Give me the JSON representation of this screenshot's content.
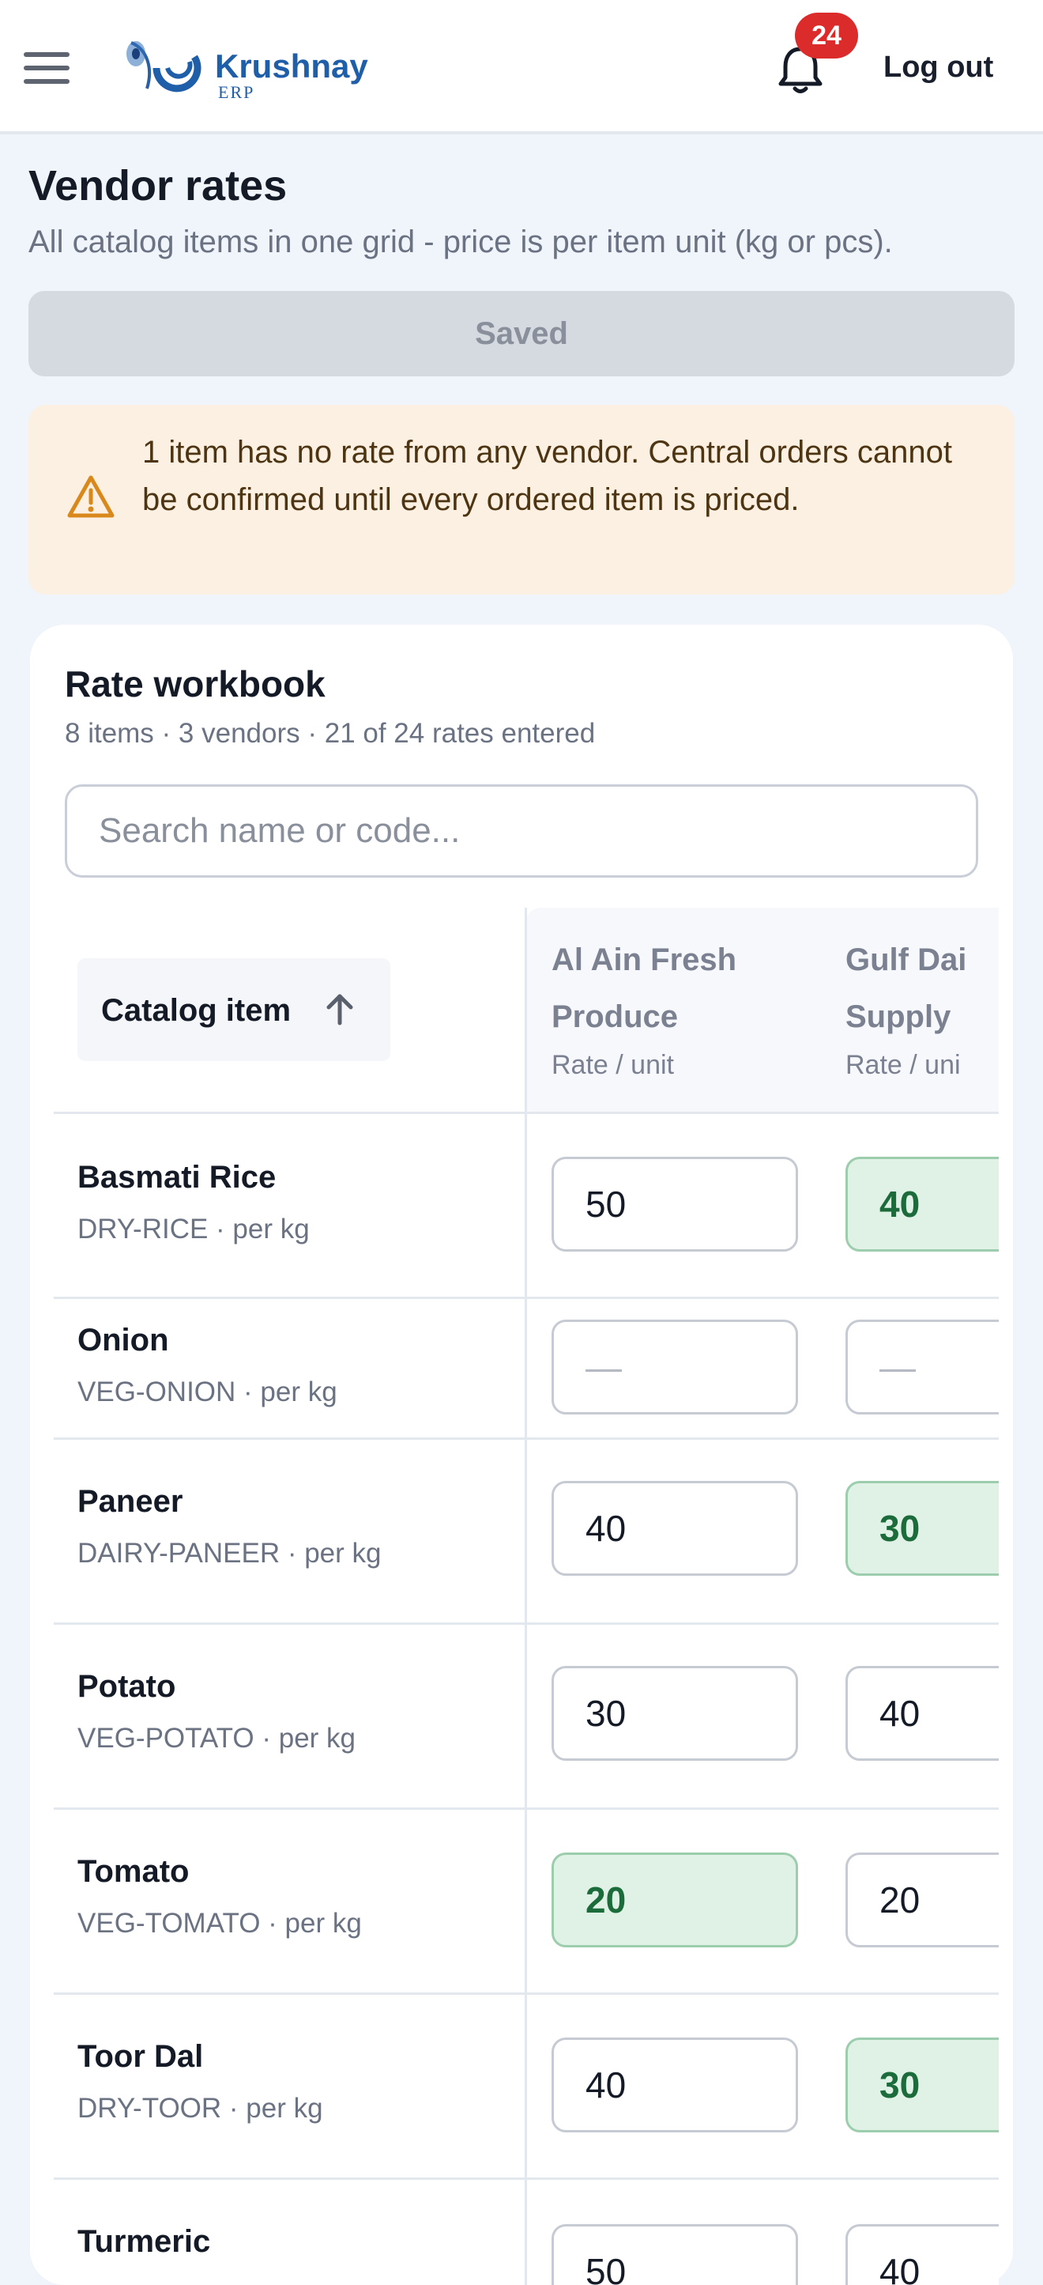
{
  "header": {
    "logo_name": "Krushnay",
    "logo_sub": "ERP",
    "notification_count": "24",
    "logout_label": "Log out"
  },
  "page": {
    "title": "Vendor rates",
    "subtitle": "All catalog items in one grid - price is per item unit (kg or pcs).",
    "saved_label": "Saved",
    "warning": "1 item has no rate from any vendor. Central orders cannot be confirmed until every ordered item is priced."
  },
  "workbook": {
    "title": "Rate workbook",
    "meta": "8 items · 3 vendors · 21 of 24 rates entered",
    "search_placeholder": "Search name or code...",
    "sort_label": "Catalog item",
    "vendors": [
      {
        "name_line1": "Al Ain Fresh",
        "name_line2": "Produce",
        "unit": "Rate / unit"
      },
      {
        "name_line1": "Gulf Dai",
        "name_line2": "Supply",
        "unit": "Rate / uni"
      }
    ],
    "rows": [
      {
        "name": "Basmati Rice",
        "meta": "DRY-RICE · per kg",
        "rates": [
          {
            "v": "50",
            "best": false
          },
          {
            "v": "40",
            "best": true
          }
        ]
      },
      {
        "name": "Onion",
        "meta": "VEG-ONION · per kg",
        "rates": [
          {
            "v": "—",
            "empty": true
          },
          {
            "v": "—",
            "empty": true
          }
        ]
      },
      {
        "name": "Paneer",
        "meta": "DAIRY-PANEER · per kg",
        "rates": [
          {
            "v": "40",
            "best": false
          },
          {
            "v": "30",
            "best": true
          }
        ]
      },
      {
        "name": "Potato",
        "meta": "VEG-POTATO · per kg",
        "rates": [
          {
            "v": "30",
            "best": false
          },
          {
            "v": "40",
            "best": false
          }
        ]
      },
      {
        "name": "Tomato",
        "meta": "VEG-TOMATO · per kg",
        "rates": [
          {
            "v": "20",
            "best": true
          },
          {
            "v": "20",
            "best": false
          }
        ]
      },
      {
        "name": "Toor Dal",
        "meta": "DRY-TOOR · per kg",
        "rates": [
          {
            "v": "40",
            "best": false
          },
          {
            "v": "30",
            "best": true
          }
        ]
      },
      {
        "name": "Turmeric",
        "meta": "",
        "rates": [
          {
            "v": "50",
            "best": false
          },
          {
            "v": "40",
            "best": false
          }
        ]
      }
    ]
  }
}
